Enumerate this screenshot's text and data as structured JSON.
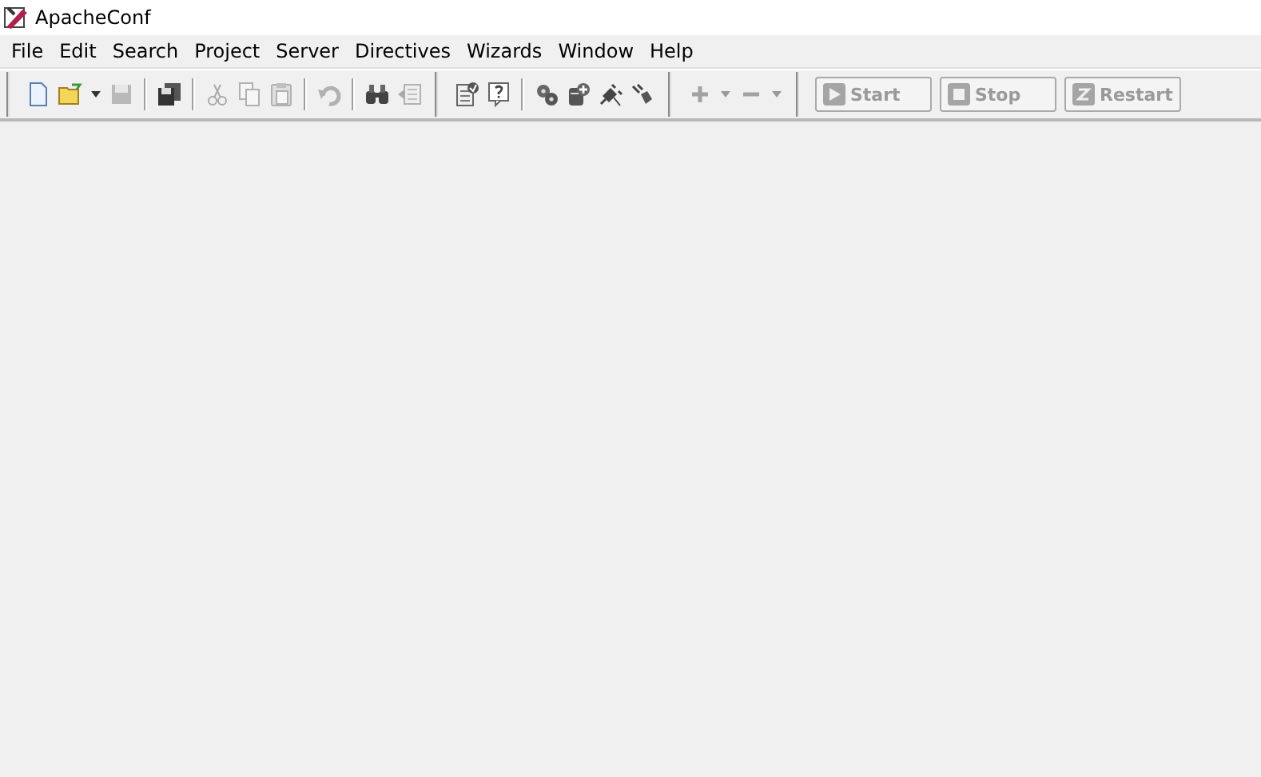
{
  "window": {
    "title": "ApacheConf"
  },
  "menu": [
    "File",
    "Edit",
    "Search",
    "Project",
    "Server",
    "Directives",
    "Wizards",
    "Window",
    "Help"
  ],
  "toolbars": [
    {
      "groups": [
        [
          {
            "kind": "new",
            "disabled": false
          },
          {
            "kind": "open",
            "disabled": false
          },
          {
            "kind": "dropdown",
            "disabled": false
          },
          {
            "kind": "save",
            "disabled": true
          }
        ],
        [
          {
            "kind": "saveall",
            "disabled": false
          }
        ],
        [
          {
            "kind": "cut",
            "disabled": true
          },
          {
            "kind": "copy",
            "disabled": true
          },
          {
            "kind": "paste",
            "disabled": true
          }
        ],
        [
          {
            "kind": "undo",
            "disabled": true
          }
        ],
        [
          {
            "kind": "find",
            "disabled": false
          },
          {
            "kind": "replace",
            "disabled": true
          }
        ]
      ]
    },
    {
      "groups": [
        [
          {
            "kind": "check",
            "disabled": false
          },
          {
            "kind": "help",
            "disabled": false
          }
        ],
        [
          {
            "kind": "gears",
            "disabled": false
          },
          {
            "kind": "adddb",
            "disabled": false
          },
          {
            "kind": "plugin",
            "disabled": false
          },
          {
            "kind": "unplug",
            "disabled": false
          }
        ]
      ]
    },
    {
      "groups": [
        [
          {
            "kind": "plus",
            "disabled": true
          },
          {
            "kind": "dropdown",
            "disabled": true
          },
          {
            "kind": "minus",
            "disabled": true
          },
          {
            "kind": "dropdown",
            "disabled": true
          }
        ]
      ]
    }
  ],
  "server_buttons": [
    {
      "label": "Start",
      "kind": "start",
      "disabled": true
    },
    {
      "label": "Stop",
      "kind": "stop",
      "disabled": true
    },
    {
      "label": "Restart",
      "kind": "restart",
      "disabled": true
    }
  ]
}
